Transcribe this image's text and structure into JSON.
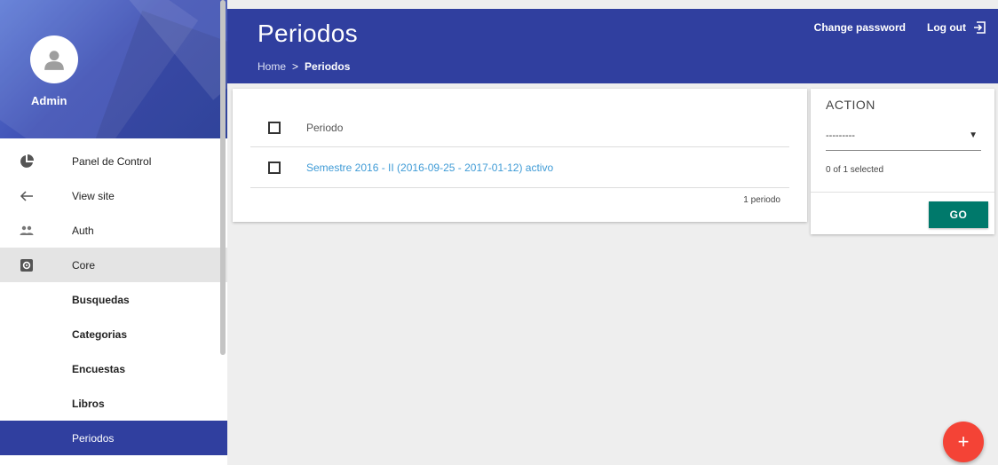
{
  "sidebar": {
    "user_name": "Admin",
    "items": [
      {
        "label": "Panel de Control",
        "icon": "pie-chart-icon"
      },
      {
        "label": "View site",
        "icon": "arrow-left-icon"
      },
      {
        "label": "Auth",
        "icon": "people-icon"
      },
      {
        "label": "Core",
        "icon": "settings-box-icon"
      }
    ],
    "sub_items": [
      {
        "label": "Busquedas"
      },
      {
        "label": "Categorias"
      },
      {
        "label": "Encuestas"
      },
      {
        "label": "Libros"
      },
      {
        "label": "Periodos"
      }
    ]
  },
  "header": {
    "title": "Periodos",
    "breadcrumb": {
      "home": "Home",
      "separator": ">",
      "current": "Periodos"
    },
    "change_password": "Change password",
    "logout": "Log out"
  },
  "results": {
    "column_header": "Periodo",
    "rows": [
      {
        "text": "Semestre 2016 - II (2016-09-25 - 2017-01-12) activo"
      }
    ],
    "count": "1 periodo"
  },
  "action": {
    "title": "ACTION",
    "selected_value": "---------",
    "selected_count": "0 of 1 selected",
    "go_label": "GO"
  },
  "fab": {
    "label": "+"
  },
  "colors": {
    "primary": "#303f9f",
    "accent_green": "#00796b",
    "fab_red": "#f44336",
    "link": "#3f9bd6"
  }
}
